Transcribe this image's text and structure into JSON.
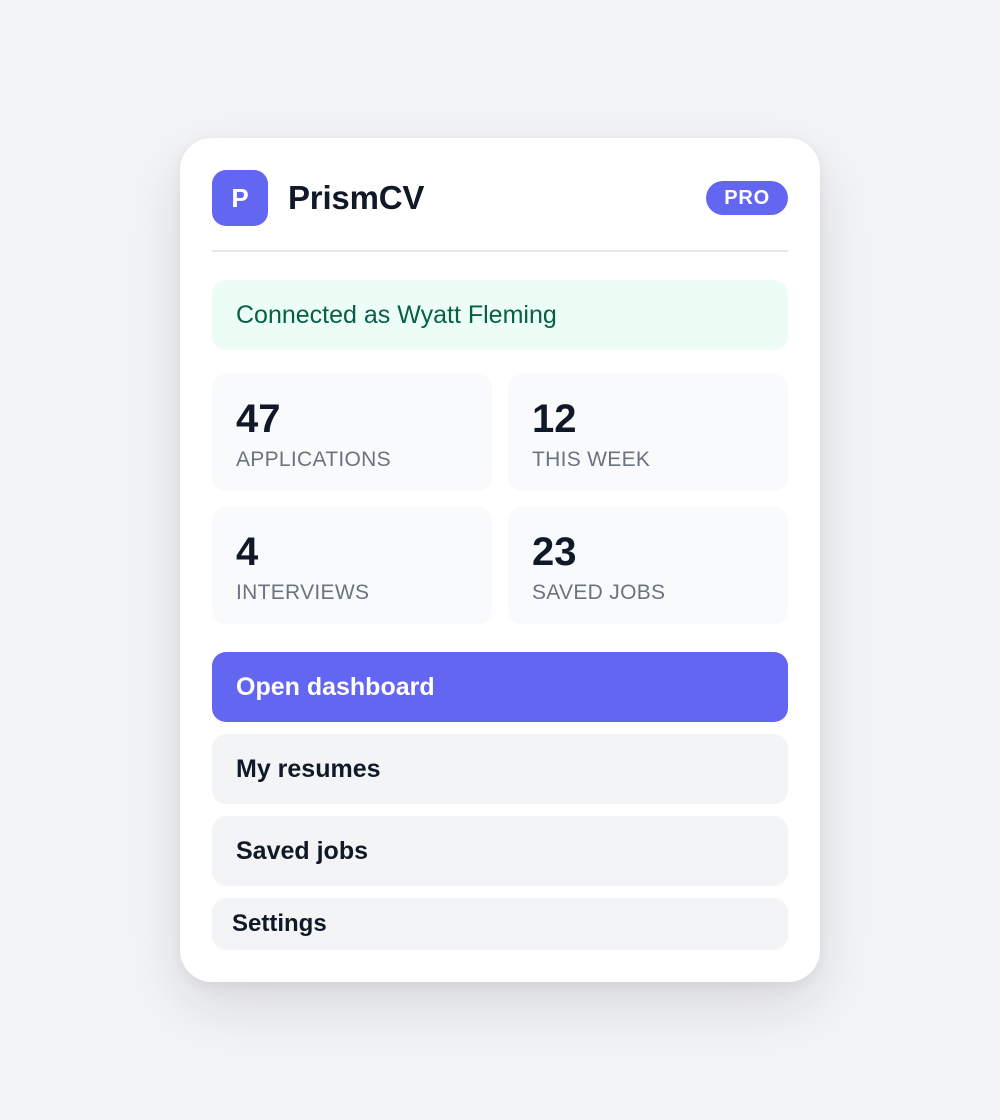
{
  "app": {
    "logo_letter": "P",
    "name": "PrismCV",
    "plan_badge": "PRO"
  },
  "status": {
    "text": "Connected as Wyatt Fleming"
  },
  "stats": [
    {
      "value": "47",
      "label": "APPLICATIONS"
    },
    {
      "value": "12",
      "label": "THIS WEEK"
    },
    {
      "value": "4",
      "label": "INTERVIEWS"
    },
    {
      "value": "23",
      "label": "SAVED JOBS"
    }
  ],
  "actions": {
    "open_dashboard": "Open dashboard",
    "my_resumes": "My resumes",
    "saved_jobs": "Saved jobs",
    "settings": "Settings"
  },
  "colors": {
    "accent": "#6366f1",
    "status_bg": "#ecfdf5",
    "status_text": "#065f46",
    "text_primary": "#111827",
    "text_muted": "#6b7280"
  }
}
